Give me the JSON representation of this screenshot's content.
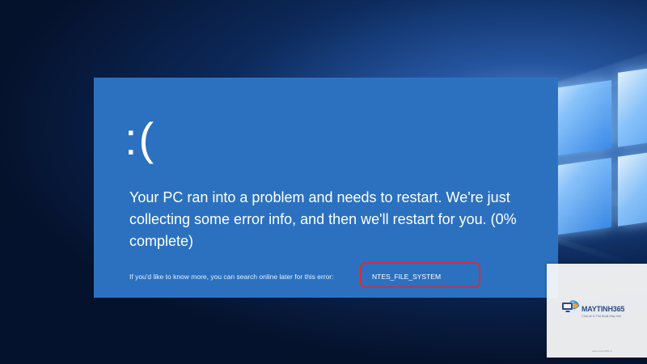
{
  "bsod": {
    "face": ":(",
    "message": "Your PC ran into a problem and needs to restart. We're just collecting some error info, and then we'll restart for you. (0% complete)",
    "search_hint": "If you'd like to know more, you can search online later for this error:",
    "error_code": "NTES_FILE_SYSTEM",
    "background_color": "#2b71bf",
    "highlight_color": "#d92b3a"
  },
  "watermark": {
    "brand": "MAYTINH365",
    "tagline": "Chia sẻ & Thủ thuật Máy tính",
    "url": "www.maytinh365.vn",
    "brand_color": "#294b8d"
  },
  "icons": {
    "watermark_logo": "computer-globe-icon"
  }
}
